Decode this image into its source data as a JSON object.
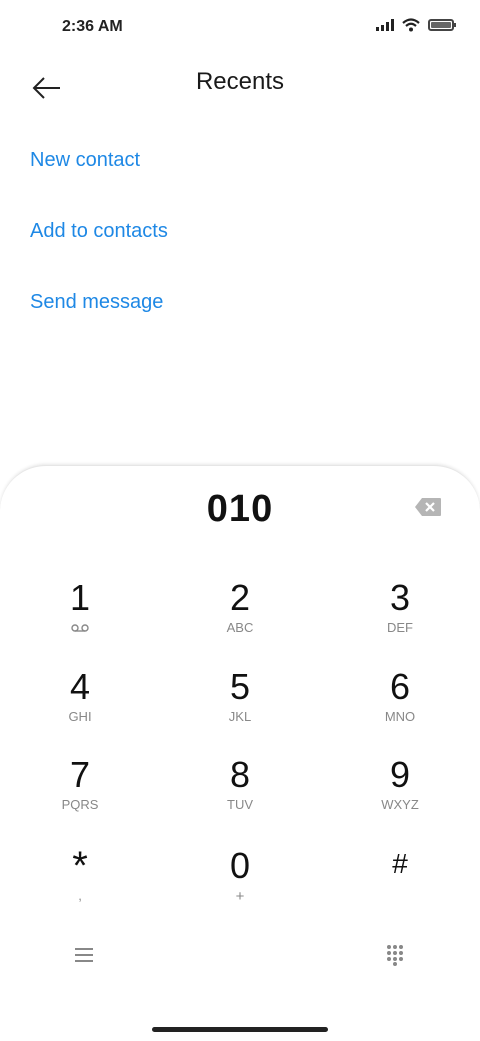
{
  "status_bar": {
    "time": "2:36 AM"
  },
  "header": {
    "title": "Recents"
  },
  "actions": [
    {
      "label": "New contact"
    },
    {
      "label": "Add to contacts"
    },
    {
      "label": "Send message"
    }
  ],
  "dialer": {
    "number": "010",
    "keys": [
      {
        "digit": "1",
        "sub": ""
      },
      {
        "digit": "2",
        "sub": "ABC"
      },
      {
        "digit": "3",
        "sub": "DEF"
      },
      {
        "digit": "4",
        "sub": "GHI"
      },
      {
        "digit": "5",
        "sub": "JKL"
      },
      {
        "digit": "6",
        "sub": "MNO"
      },
      {
        "digit": "7",
        "sub": "PQRS"
      },
      {
        "digit": "8",
        "sub": "TUV"
      },
      {
        "digit": "9",
        "sub": "WXYZ"
      },
      {
        "digit": "*",
        "sub": ","
      },
      {
        "digit": "0",
        "sub": "+"
      },
      {
        "digit": "#",
        "sub": ""
      }
    ]
  },
  "colors": {
    "accent": "#1e88e5",
    "text": "#111111",
    "subtext": "#888888"
  },
  "icons": [
    "back-arrow-icon",
    "backspace-icon",
    "voicemail-icon",
    "menu-icon",
    "dialpad-icon",
    "wifi-icon",
    "signal-icon",
    "battery-icon"
  ]
}
